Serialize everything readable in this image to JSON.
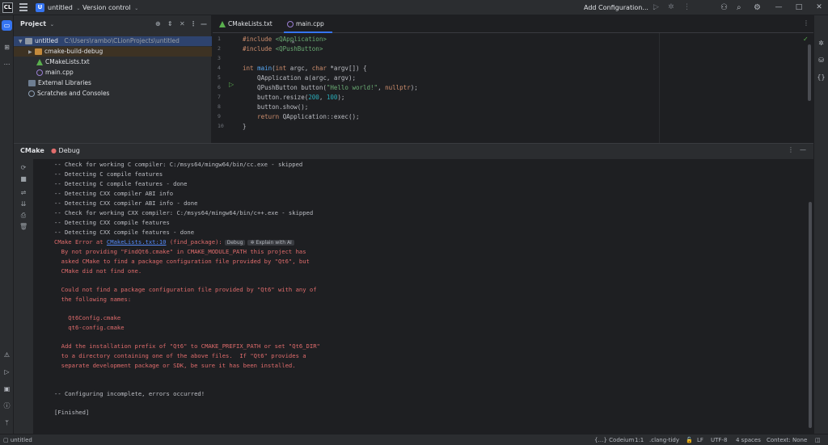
{
  "titlebar": {
    "app_logo": "CL",
    "project_badge": "U",
    "project_name": "untitled",
    "vcs_label": "Version control",
    "run_config": "Add Configuration...",
    "minimize": "—",
    "maximize": "□",
    "close": "✕"
  },
  "project_panel": {
    "title": "Project",
    "tree": [
      {
        "label": "untitled",
        "path": "C:\\Users\\rambo\\CLionProjects\\untitled"
      },
      {
        "label": "cmake-build-debug"
      },
      {
        "label": "CMakeLists.txt"
      },
      {
        "label": "main.cpp"
      },
      {
        "label": "External Libraries"
      },
      {
        "label": "Scratches and Consoles"
      }
    ]
  },
  "editor": {
    "tabs": [
      {
        "label": "CMakeLists.txt"
      },
      {
        "label": "main.cpp"
      }
    ],
    "line_numbers": [
      "1",
      "2",
      "3",
      "4",
      "5",
      "6",
      "7",
      "8",
      "9",
      "10"
    ]
  },
  "bottom": {
    "tabs": [
      {
        "label": "CMake"
      },
      {
        "label": "Debug"
      }
    ],
    "output": [
      "-- Check for working C compiler: C:/msys64/mingw64/bin/cc.exe - skipped",
      "-- Detecting C compile features",
      "-- Detecting C compile features - done",
      "-- Detecting CXX compiler ABI info",
      "-- Detecting CXX compiler ABI info - done",
      "-- Check for working CXX compiler: C:/msys64/mingw64/bin/c++.exe - skipped",
      "-- Detecting CXX compile features",
      "-- Detecting CXX compile features - done"
    ],
    "error_prefix": "CMake Error at ",
    "error_link": "CMakeLists.txt:10",
    "error_suffix": " (find_package):",
    "debug_pill": "Debug",
    "explain_pill": "Explain with AI",
    "error_lines": [
      "  By not providing \"FindQt6.cmake\" in CMAKE_MODULE_PATH this project has",
      "  asked CMake to find a package configuration file provided by \"Qt6\", but",
      "  CMake did not find one.",
      "",
      "  Could not find a package configuration file provided by \"Qt6\" with any of",
      "  the following names:",
      "",
      "    Qt6Config.cmake",
      "    qt6-config.cmake",
      "",
      "  Add the installation prefix of \"Qt6\" to CMAKE_PREFIX_PATH or set \"Qt6_DIR\"",
      "  to a directory containing one of the above files.  If \"Qt6\" provides a",
      "  separate development package or SDK, be sure it has been installed."
    ],
    "footer_lines": [
      "-- Configuring incomplete, errors occurred!",
      "",
      "[Finished]"
    ]
  },
  "status": {
    "breadcrumb": "untitled",
    "codeium": "Codeium",
    "position": "1:1",
    "inspection": ".clang-tidy",
    "line_sep": "LF",
    "encoding": "UTF-8",
    "indent": "4 spaces",
    "context": "Context: None"
  }
}
